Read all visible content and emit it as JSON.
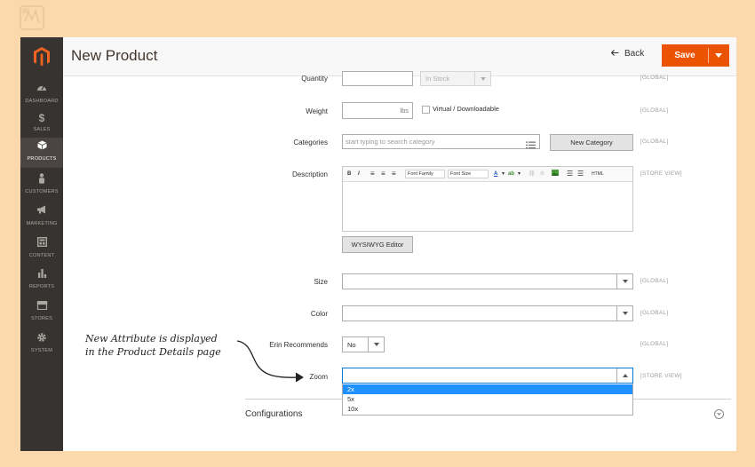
{
  "app": {
    "title": "New Product",
    "back_label": "Back",
    "save_label": "Save"
  },
  "sidebar": {
    "items": [
      {
        "label": "DASHBOARD",
        "icon": "dashboard-icon"
      },
      {
        "label": "SALES",
        "icon": "dollar-icon"
      },
      {
        "label": "PRODUCTS",
        "icon": "cube-icon",
        "active": true
      },
      {
        "label": "CUSTOMERS",
        "icon": "person-icon"
      },
      {
        "label": "MARKETING",
        "icon": "megaphone-icon"
      },
      {
        "label": "CONTENT",
        "icon": "layout-icon"
      },
      {
        "label": "REPORTS",
        "icon": "bar-chart-icon"
      },
      {
        "label": "STORES",
        "icon": "store-icon"
      },
      {
        "label": "SYSTEM",
        "icon": "gear-icon"
      }
    ]
  },
  "form": {
    "quantity": {
      "label": "Quantity",
      "value": "",
      "stock_status": "In Stock",
      "scope": "[GLOBAL]"
    },
    "weight": {
      "label": "Weight",
      "unit": "lbs",
      "virtual_label": "Virtual / Downloadable",
      "scope": "[GLOBAL]"
    },
    "categories": {
      "label": "Categories",
      "placeholder": "start typing to search category",
      "button": "New Category",
      "scope": "[GLOBAL]"
    },
    "description": {
      "label": "Description",
      "scope": "[STORE VIEW]",
      "toolbar": {
        "bold": "B",
        "italic": "I",
        "font_family": "Font Family",
        "font_size": "Font Size",
        "text_color": "A",
        "html": "HTML"
      },
      "wysiwyg_button": "WYSIWYG Editor"
    },
    "size": {
      "label": "Size",
      "value": "",
      "scope": "[GLOBAL]"
    },
    "color": {
      "label": "Color",
      "value": "",
      "scope": "[GLOBAL]"
    },
    "erin_recommends": {
      "label": "Erin Recommends",
      "value": "No",
      "scope": "[GLOBAL]"
    },
    "zoom": {
      "label": "Zoom",
      "value": "",
      "options": [
        "2x",
        "5x",
        "10x"
      ],
      "highlighted": "2x",
      "scope": "[STORE VIEW]"
    }
  },
  "sections": {
    "configurations": "Configurations"
  },
  "annotation": {
    "line1": "New Attribute is displayed",
    "line2": "in the Product Details page"
  },
  "colors": {
    "accent": "#eb5202",
    "sidebar": "#373330",
    "background": "#fbd9ad",
    "highlight": "#1e90ff"
  }
}
